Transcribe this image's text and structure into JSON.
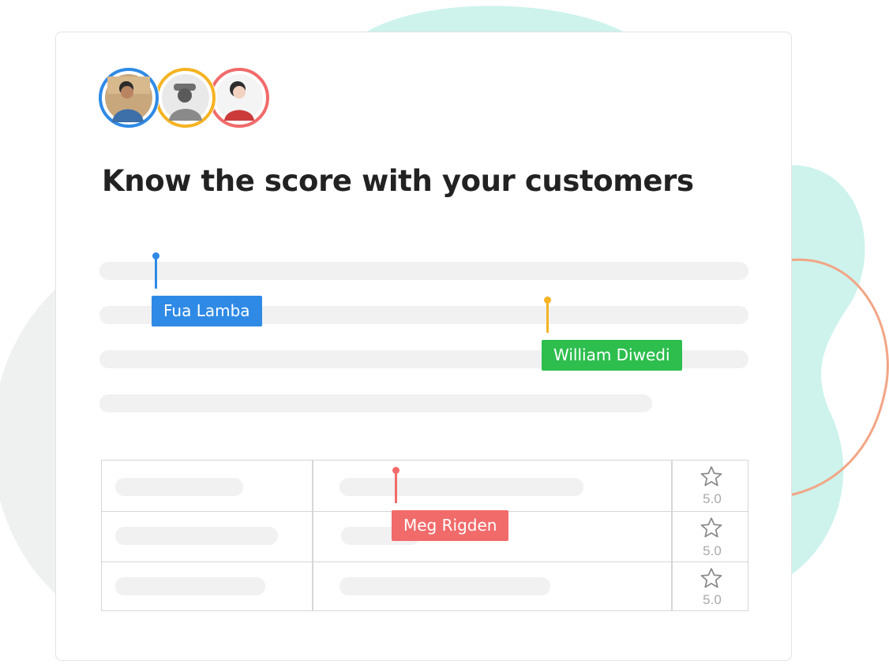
{
  "headline": "Know the score with your customers",
  "collaborators": [
    {
      "name": "Fua Lamba",
      "color": "#2f8ae5"
    },
    {
      "name": "William Diwedi",
      "color": "#2dbe4e"
    },
    {
      "name": "Meg Rigden",
      "color": "#f16b6b"
    }
  ],
  "avatars": [
    {
      "ring_color": "#2f8ae5",
      "icon": "person-avatar"
    },
    {
      "ring_color": "#f5b323",
      "icon": "person-avatar"
    },
    {
      "ring_color": "#f16b6b",
      "icon": "person-avatar"
    }
  ],
  "pin_colors": {
    "blue": "#2f8ae5",
    "yellow": "#f5b323",
    "red": "#f16b6b"
  },
  "table": {
    "rows": [
      {
        "rating": "5.0",
        "icon": "star-icon"
      },
      {
        "rating": "5.0",
        "icon": "star-icon"
      },
      {
        "rating": "5.0",
        "icon": "star-icon"
      }
    ]
  }
}
